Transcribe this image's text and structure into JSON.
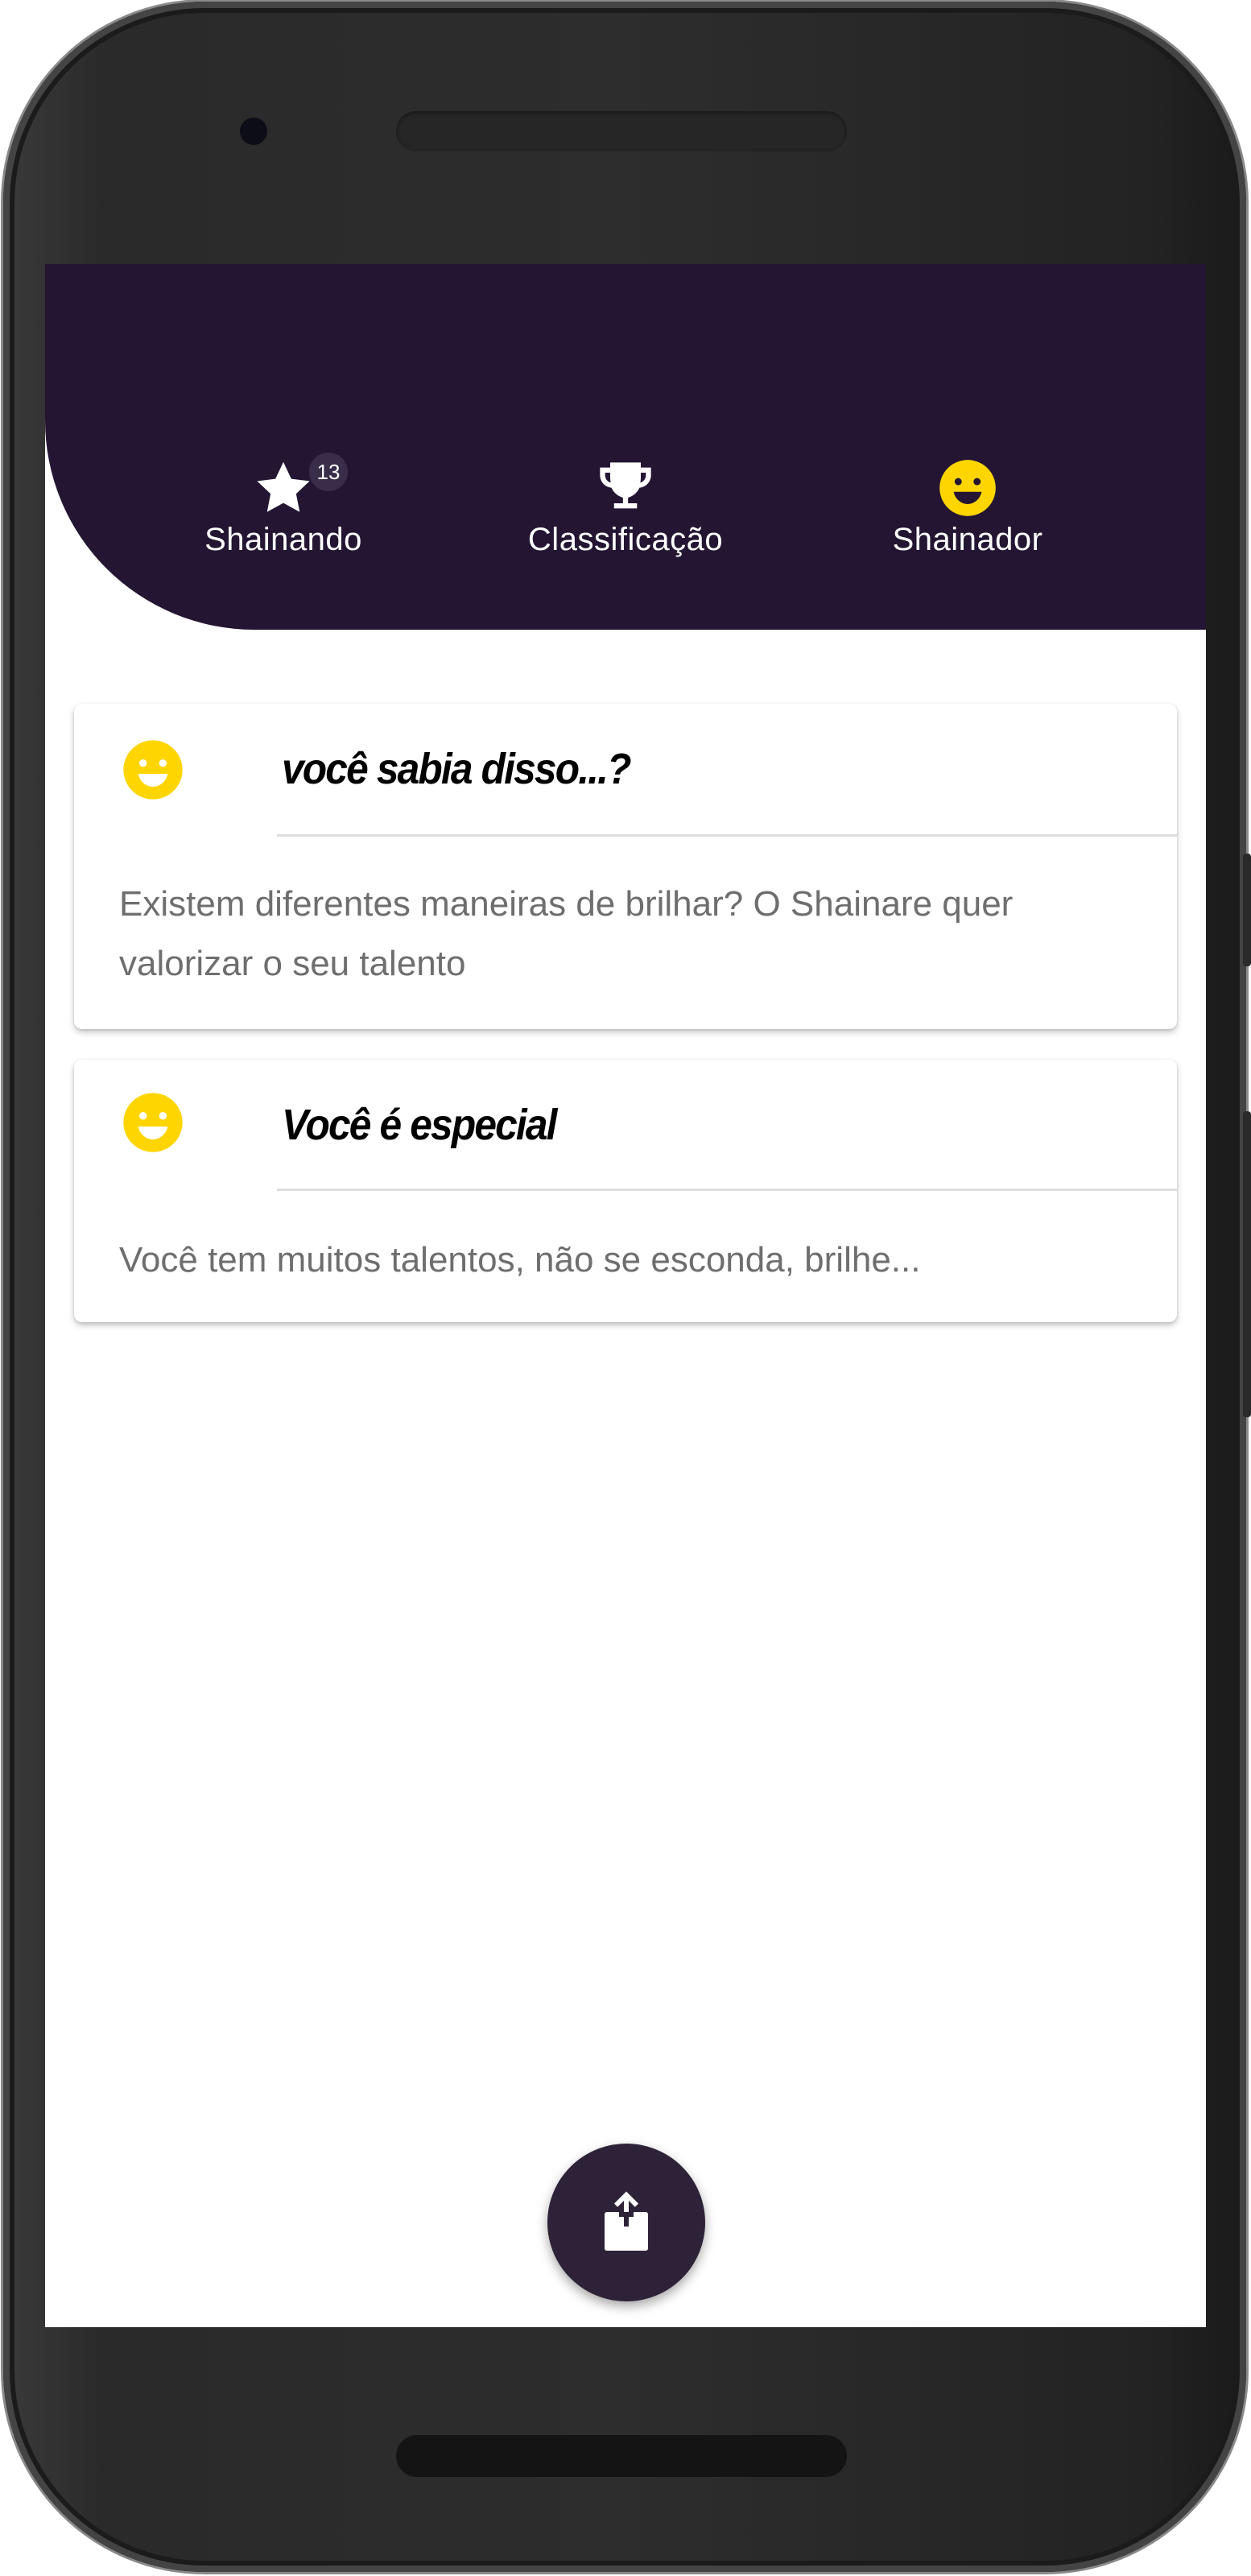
{
  "theme": {
    "header_color": "#241533",
    "accent_yellow": "#FFD500",
    "fab_color": "#2E2238"
  },
  "tabs": [
    {
      "label": "Shainando",
      "icon": "star-icon",
      "badge": "13"
    },
    {
      "label": "Classificação",
      "icon": "trophy-icon"
    },
    {
      "label": "Shainador",
      "icon": "smiley-icon"
    }
  ],
  "cards": [
    {
      "icon": "smiley-icon",
      "title": "você sabia disso...?",
      "body": "Existem diferentes maneiras de brilhar? O Shainare quer valorizar o seu talento"
    },
    {
      "icon": "smiley-icon",
      "title": "Você é especial",
      "body": "Você tem muitos talentos, não se esconda, brilhe..."
    }
  ],
  "fab": {
    "icon": "share-icon"
  }
}
